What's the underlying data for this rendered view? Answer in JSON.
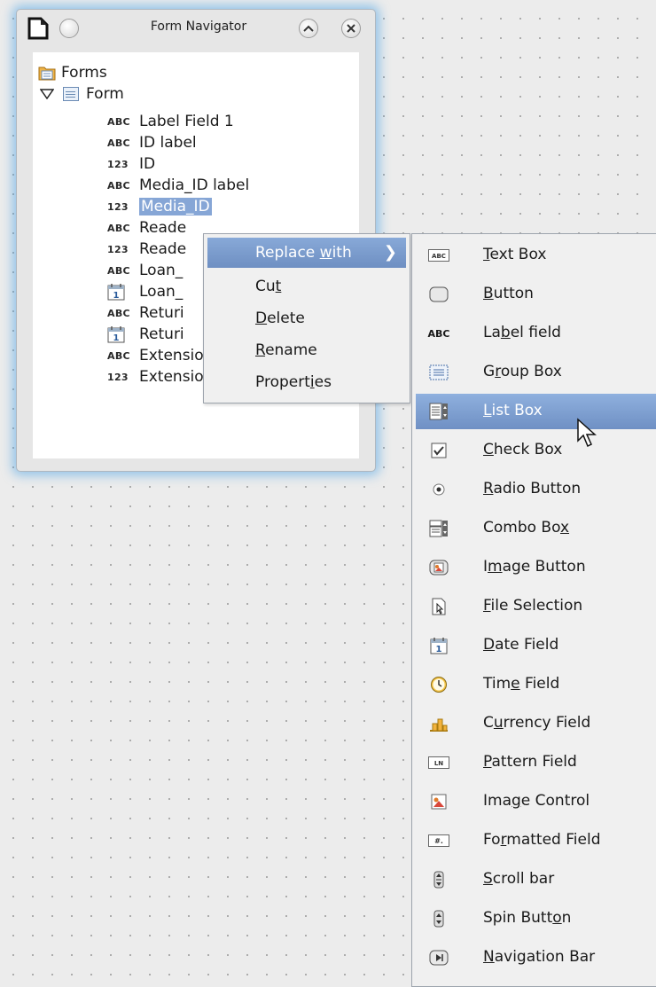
{
  "window": {
    "title": "Form Navigator",
    "minimize_glyph": "⌃",
    "close_glyph": "✕"
  },
  "tree": {
    "root_label": "Forms",
    "form_label": "Form",
    "items": [
      {
        "type": "ABC",
        "label": "Label Field 1"
      },
      {
        "type": "ABC",
        "label": "ID label"
      },
      {
        "type": "123",
        "label": "ID"
      },
      {
        "type": "ABC",
        "label": "Media_ID label"
      },
      {
        "type": "123",
        "label": "Media_ID",
        "selected": true
      },
      {
        "type": "ABC",
        "label": "Reade"
      },
      {
        "type": "123",
        "label": "Reade"
      },
      {
        "type": "ABC",
        "label": "Loan_"
      },
      {
        "type": "calendar",
        "label": "Loan_"
      },
      {
        "type": "ABC",
        "label": "Returi"
      },
      {
        "type": "calendar",
        "label": "Returi"
      },
      {
        "type": "ABC",
        "label": "Extension label"
      },
      {
        "type": "123",
        "label": "Extension"
      }
    ]
  },
  "context_menu": {
    "replace_with": "Replace with",
    "cut": "Cut",
    "delete": "Delete",
    "rename": "Rename",
    "properties": "Properties"
  },
  "submenu": {
    "items": [
      {
        "icon": "text-box-icon",
        "label": "Text Box"
      },
      {
        "icon": "button-icon",
        "label": "Button"
      },
      {
        "icon": "label-field-icon",
        "label": "Label field"
      },
      {
        "icon": "group-box-icon",
        "label": "Group Box"
      },
      {
        "icon": "list-box-icon",
        "label": "List Box",
        "highlighted": true
      },
      {
        "icon": "check-box-icon",
        "label": "Check Box"
      },
      {
        "icon": "radio-button-icon",
        "label": "Radio Button"
      },
      {
        "icon": "combo-box-icon",
        "label": "Combo Box"
      },
      {
        "icon": "image-button-icon",
        "label": "Image Button"
      },
      {
        "icon": "file-selection-icon",
        "label": "File Selection"
      },
      {
        "icon": "date-field-icon",
        "label": "Date Field"
      },
      {
        "icon": "time-field-icon",
        "label": "Time Field"
      },
      {
        "icon": "currency-field-icon",
        "label": "Currency Field"
      },
      {
        "icon": "pattern-field-icon",
        "label": "Pattern Field"
      },
      {
        "icon": "image-control-icon",
        "label": "Image Control"
      },
      {
        "icon": "formatted-field-icon",
        "label": "Formatted Field"
      },
      {
        "icon": "scroll-bar-icon",
        "label": "Scroll bar"
      },
      {
        "icon": "spin-button-icon",
        "label": "Spin Button"
      },
      {
        "icon": "navigation-bar-icon",
        "label": "Navigation Bar"
      }
    ]
  },
  "colors": {
    "selection": "#86a6d6",
    "menu_highlight": "#7b9bcd",
    "window_glow": "#46a0e6"
  }
}
